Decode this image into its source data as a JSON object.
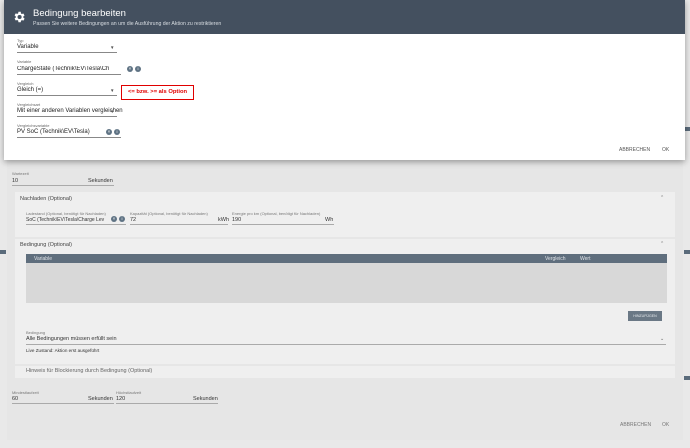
{
  "background": {
    "wartezeit": {
      "label": "Wartezeit",
      "value": "10",
      "unit": "Sekunden"
    },
    "nachladen": {
      "title": "Nachladen (Optional)",
      "fields": [
        {
          "label": "Ladestand (Optional, benötigt für Nachladen)",
          "value": "SoC (Technik\\EV\\Tesla\\Charge Lev"
        },
        {
          "label": "Kapazität (Optional, benötigt für Nachladen)",
          "value": "72",
          "unit": "kWh"
        },
        {
          "label": "Energie pro km (Optional, benötigt für Nachladen)",
          "value": "190",
          "unit": "Wh"
        }
      ]
    },
    "bedingung": {
      "title": "Bedingung (Optional)",
      "table_headers": {
        "variable": "Variable",
        "vergleich": "Vergleich",
        "wert": "Wert"
      },
      "add_button": "HINZUFÜGEN",
      "bedingung_field": {
        "label": "Bedingung",
        "value": "Alle Bedingungen müssen erfüllt sein"
      },
      "live_status": "Live Zustand: Aktion erst ausgeführt",
      "hinweis": "Hinweis für Blockierung durch Bedingung (Optional)"
    },
    "min_laufzeit": {
      "label": "Mindestlaufzeit",
      "value": "60",
      "unit": "Sekunden"
    },
    "max_laufzeit": {
      "label": "Höchstlaufzeit",
      "value": "120",
      "unit": "Sekunden"
    },
    "footer": {
      "cancel": "ABBRECHEN",
      "ok": "OK"
    }
  },
  "modal": {
    "title": "Bedingung bearbeiten",
    "subtitle": "Passen Sie weitere Bedingungen an um die Ausführung der Aktion zu restriktieren",
    "fields": {
      "typ": {
        "label": "Typ",
        "value": "Variable"
      },
      "variable": {
        "label": "Variable",
        "value": "ChargeState (Technik\\EV\\Tesla\\Ch"
      },
      "vergleich": {
        "label": "Vergleich",
        "value": "Gleich (=)"
      },
      "vergleichsart": {
        "label": "Vergleichsart",
        "value": "Mit einer anderen Variablen vergleichen"
      },
      "vergleichsvariable": {
        "label": "Vergleichsvariable",
        "value": "PV SoC (Technik\\EV\\Tesla)"
      }
    },
    "annotation": "<= bzw. >= als Option",
    "footer": {
      "cancel": "ABBRECHEN",
      "ok": "OK"
    }
  },
  "colors": {
    "header": "#44505f",
    "accent": "#5f7384",
    "annotation": "#e00000"
  }
}
